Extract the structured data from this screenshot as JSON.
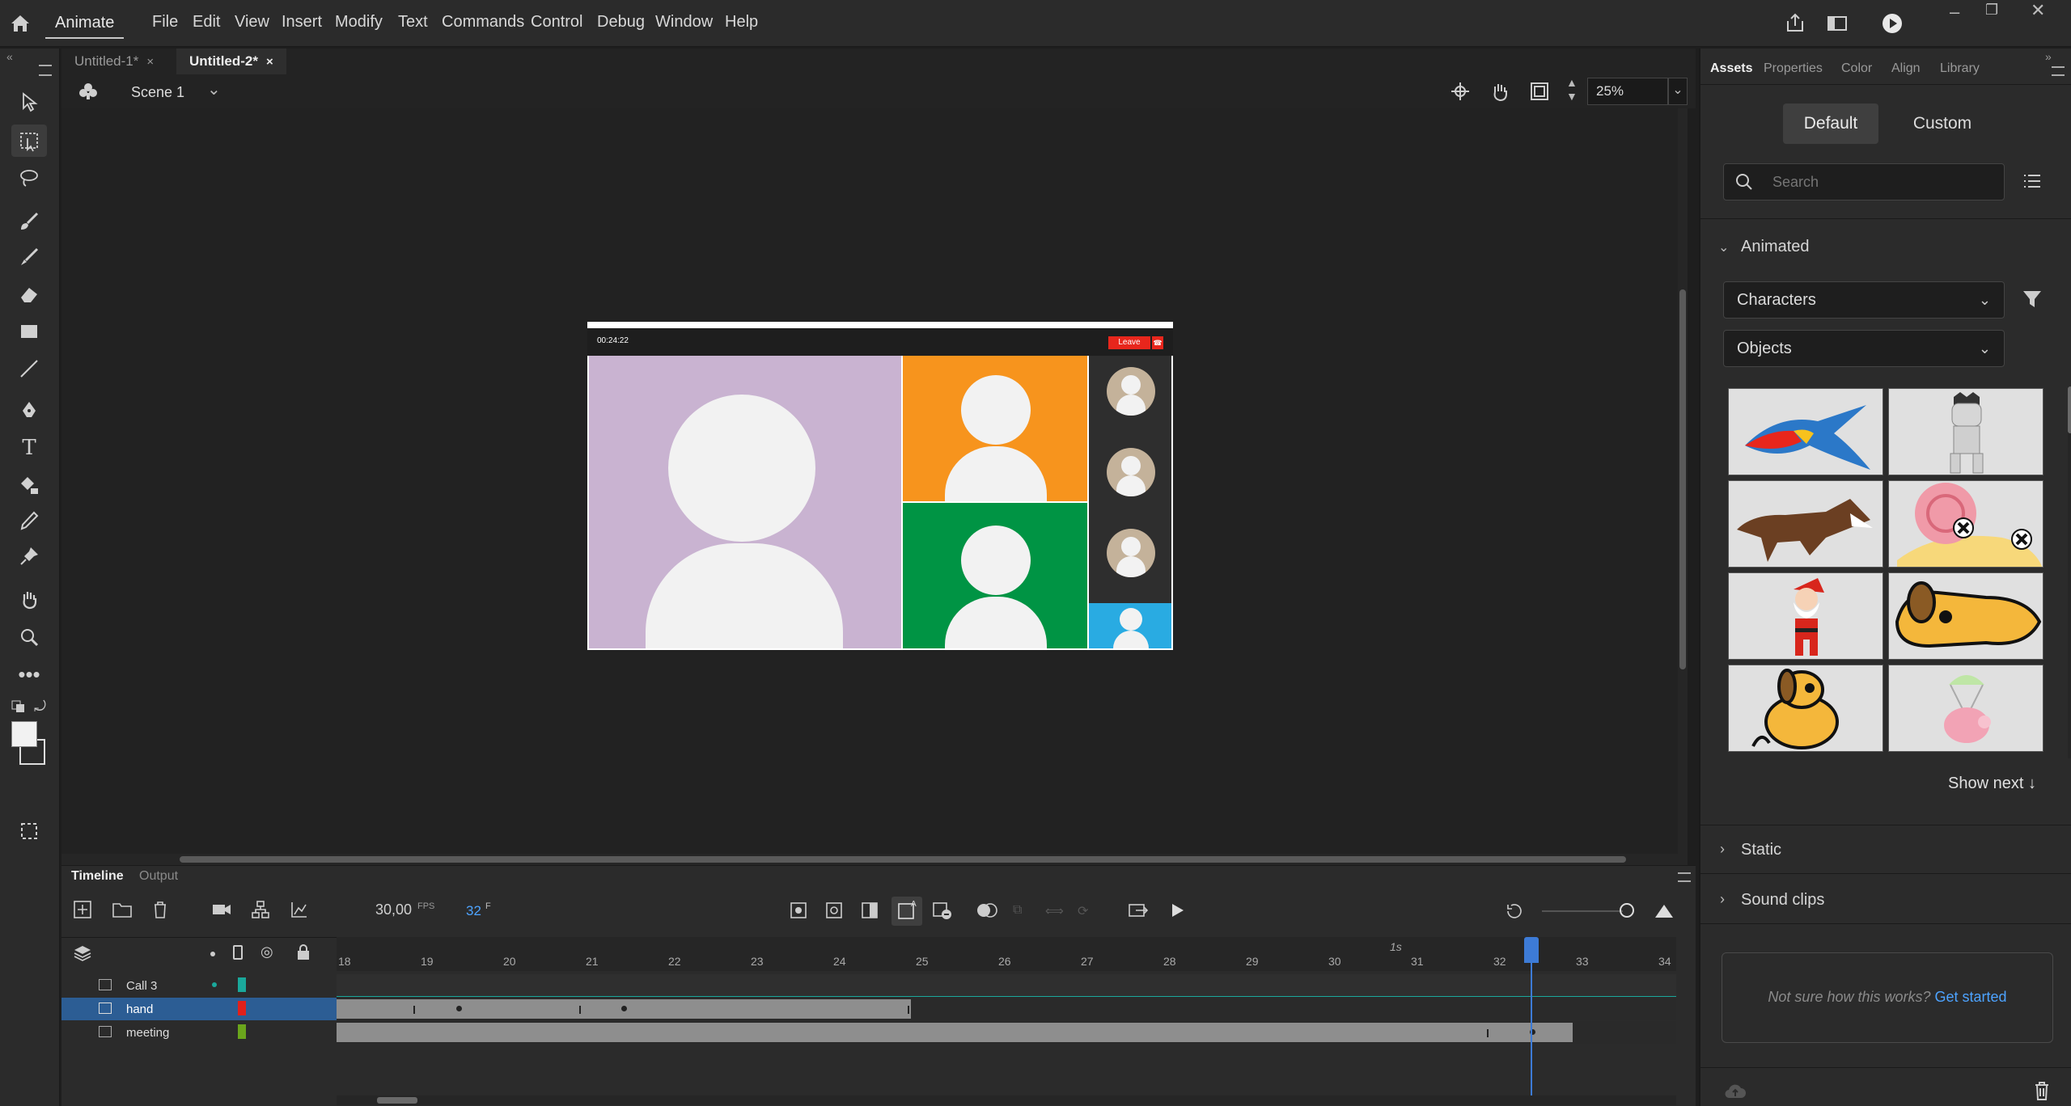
{
  "menubar": {
    "app_name": "Animate",
    "items": [
      "File",
      "Edit",
      "View",
      "Insert",
      "Modify",
      "Text",
      "Commands",
      "Control",
      "Debug",
      "Window",
      "Help"
    ]
  },
  "doc_tabs": [
    {
      "label": "Untitled-1*",
      "close": "×"
    },
    {
      "label": "Untitled-2*",
      "close": "×"
    }
  ],
  "scene": {
    "label": "Scene 1",
    "zoom": "25%"
  },
  "stage_content": {
    "timer": "00:24:22",
    "leave_label": "Leave",
    "colors": {
      "main": "#c9b3d1",
      "orange": "#f7941d",
      "green": "#009444",
      "blue": "#29abe2",
      "sidebar": "#2e2e2e",
      "avatar": "#f2f2f2",
      "thumb": "#c4b29a",
      "leave": "#e8261c"
    }
  },
  "timeline": {
    "tabs": [
      "Timeline",
      "Output"
    ],
    "fps": "30,00",
    "fps_unit": "FPS",
    "frame": "32",
    "frame_unit": "F",
    "time_marker": "1s",
    "ruler": [
      "18",
      "19",
      "20",
      "21",
      "22",
      "23",
      "24",
      "25",
      "26",
      "27",
      "28",
      "29",
      "30",
      "31",
      "32",
      "33",
      "34"
    ],
    "layers": [
      {
        "name": "Call 3",
        "color": "#1aa89b"
      },
      {
        "name": "hand",
        "color": "#e0201b"
      },
      {
        "name": "meeting",
        "color": "#6aa51c"
      }
    ]
  },
  "right_panel": {
    "tabs": [
      "Assets",
      "Properties",
      "Color",
      "Align",
      "Library"
    ],
    "segments": [
      "Default",
      "Custom"
    ],
    "search_placeholder": "Search",
    "sections": {
      "animated": "Animated",
      "static": "Static",
      "sound": "Sound clips"
    },
    "dropdowns": [
      "Characters",
      "Objects"
    ],
    "show_next": "Show next ↓",
    "help_text": "Not sure how this works?",
    "help_link": "Get started"
  }
}
